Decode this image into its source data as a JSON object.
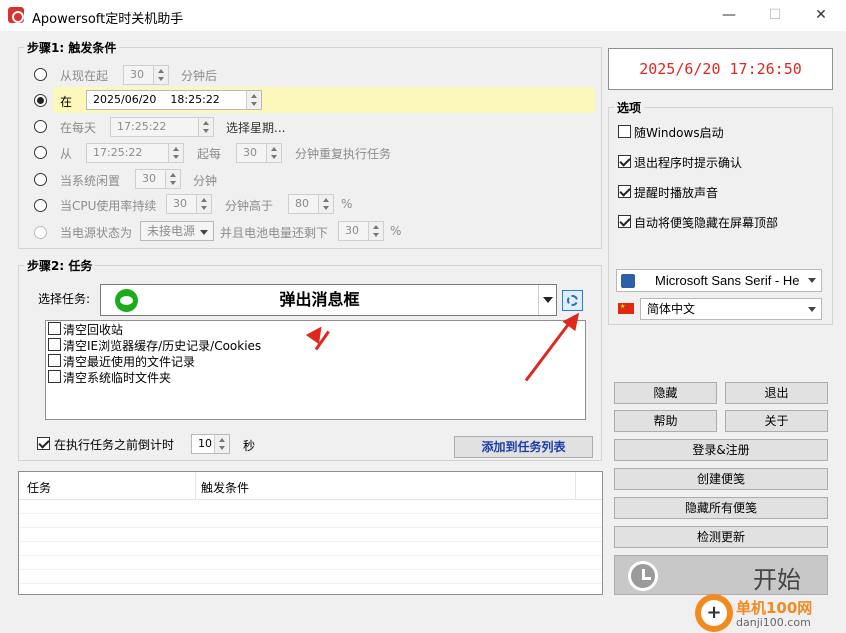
{
  "window": {
    "title": "Apowersoft定时关机助手",
    "minimize": "—",
    "maximize": "☐",
    "close": "✕"
  },
  "clock": {
    "value": "2025/6/20  17:26:50",
    "color": "#e0271f"
  },
  "step1": {
    "legend": "步骤1: 触发条件",
    "r1": {
      "label": "从现在起",
      "value": "30",
      "suffix": "分钟后"
    },
    "r2": {
      "label": "在",
      "date": "2025/06/20",
      "time": "18:25:22"
    },
    "r3": {
      "label": "在每天",
      "time": "17:25:22",
      "extra": "选择星期..."
    },
    "r4": {
      "label": "从",
      "time": "17:25:22",
      "mid": "起每",
      "value": "30",
      "suffix": "分钟重复执行任务"
    },
    "r5": {
      "label": "当系统闲置",
      "value": "30",
      "suffix": "分钟"
    },
    "r6": {
      "label": "当CPU使用率持续",
      "value": "30",
      "mid": "分钟高于",
      "pct": "80",
      "unit": "%"
    },
    "r7": {
      "label": "当电源状态为",
      "select": "未接电源",
      "mid": "并且电池电量还剩下",
      "pct": "30",
      "unit": "%"
    }
  },
  "options": {
    "legend": "选项",
    "items": [
      {
        "label": "随Windows启动",
        "checked": false
      },
      {
        "label": "退出程序时提示确认",
        "checked": true
      },
      {
        "label": "提醒时播放声音",
        "checked": true
      },
      {
        "label": "自动将便笺隐藏在屏幕顶部",
        "checked": true
      }
    ],
    "font": "Microsoft Sans Serif   - He",
    "language": "简体中文"
  },
  "step2": {
    "legend": "步骤2: 任务",
    "select_label": "选择任务:",
    "task": "弹出消息框",
    "list": [
      "清空回收站",
      "清空IE浏览器缓存/历史记录/Cookies",
      "清空最近使用的文件记录",
      "清空系统临时文件夹"
    ],
    "countdown_label": "在执行任务之前倒计时",
    "countdown_value": "10",
    "countdown_unit": "秒",
    "add_button": "添加到任务列表"
  },
  "table": {
    "col_task": "任务",
    "col_trigger": "触发条件"
  },
  "buttons": {
    "hide": "隐藏",
    "exit": "退出",
    "help": "帮助",
    "about": "关于",
    "login": "登录&注册",
    "create_note": "创建便笺",
    "hide_notes": "隐藏所有便笺",
    "check_update": "检测更新",
    "start": "开始"
  },
  "watermark": {
    "name": "单机100网",
    "url": "danji100.com"
  }
}
